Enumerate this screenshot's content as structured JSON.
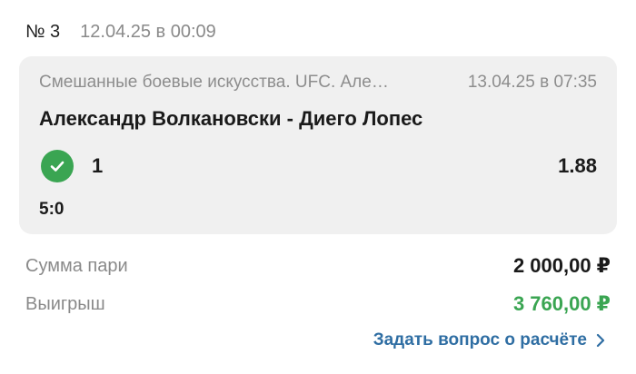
{
  "header": {
    "bet_number": "№ 3",
    "placed_at": "12.04.25 в 00:09"
  },
  "event": {
    "league": "Смешанные боевые искусства. UFC. Але…",
    "start_time": "13.04.25 в 07:35",
    "title": "Александр Волкановски - Диего Лопес",
    "outcome": "1",
    "odds": "1.88",
    "score": "5:0",
    "status_icon": "check-circle-icon",
    "status_color": "#3aa552"
  },
  "summary": {
    "stake_label": "Сумма пари",
    "stake_value": "2 000,00 ₽",
    "win_label": "Выигрыш",
    "win_value": "3 760,00 ₽",
    "win_color": "#3aa552"
  },
  "actions": {
    "ask_label": "Задать вопрос о расчёте",
    "link_color": "#2f6ea3"
  }
}
